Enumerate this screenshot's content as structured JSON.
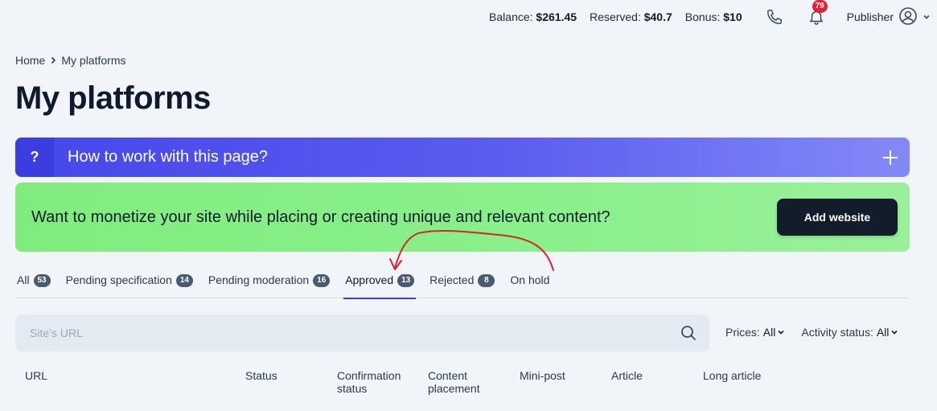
{
  "header": {
    "balance_label": "Balance:",
    "balance_value": "$261.45",
    "reserved_label": "Reserved:",
    "reserved_value": "$40.7",
    "bonus_label": "Bonus:",
    "bonus_value": "$10",
    "notifications_count": "79",
    "user_role": "Publisher",
    "icons": [
      "phone-icon",
      "bell-icon",
      "user-icon",
      "chevron-down-icon"
    ]
  },
  "breadcrumb": {
    "home": "Home",
    "current": "My platforms"
  },
  "page_title": "My platforms",
  "help_bar": {
    "icon": "?",
    "text": "How to work with this page?"
  },
  "promo": {
    "text": "Want to monetize your site while placing or creating unique and relevant content?",
    "button": "Add website"
  },
  "tabs": [
    {
      "label": "All",
      "count": "53"
    },
    {
      "label": "Pending specification",
      "count": "14"
    },
    {
      "label": "Pending moderation",
      "count": "16"
    },
    {
      "label": "Approved",
      "count": "13",
      "active": true
    },
    {
      "label": "Rejected",
      "count": "8"
    },
    {
      "label": "On hold"
    }
  ],
  "search": {
    "placeholder": "Site’s URL",
    "value": ""
  },
  "filters": {
    "prices_label": "Prices:",
    "prices_value": "All",
    "activity_label": "Activity status:",
    "activity_value": "All"
  },
  "table": {
    "headers": [
      "URL",
      "Status",
      "Confirmation status",
      "Content placement",
      "Mini-post",
      "Article",
      "Long article"
    ]
  },
  "colors": {
    "accent": "#3a3de0",
    "badge_red": "#e5203a",
    "promo_green": "#86ee85",
    "dark_button": "#121c2b",
    "annotation_red": "#d6242c"
  }
}
